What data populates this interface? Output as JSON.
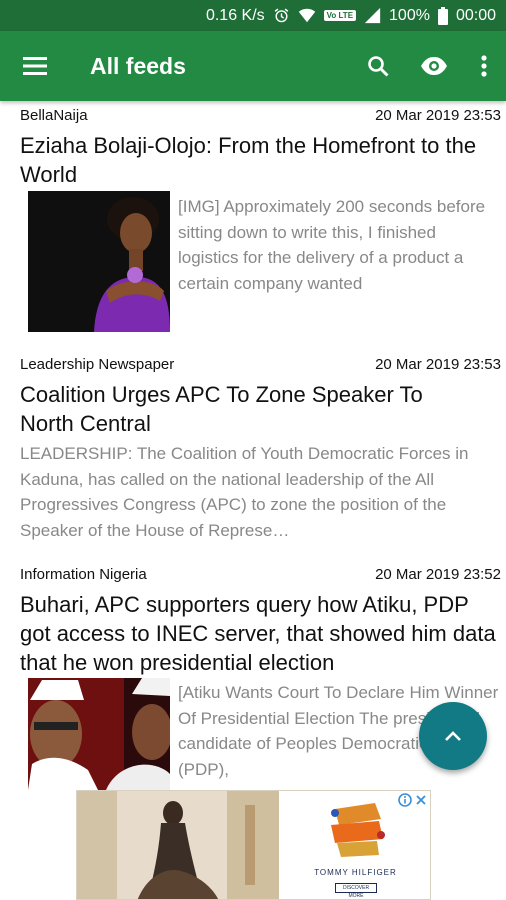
{
  "status_bar": {
    "speed": "0.16 K/s",
    "volte": "Vo LTE",
    "battery": "100%",
    "time": "00:00"
  },
  "toolbar": {
    "title": "All feeds",
    "menu_icon": "hamburger-menu-icon",
    "search_icon": "search-icon",
    "eye_icon": "eye-icon",
    "overflow_icon": "more-vert-icon",
    "color": "#238a43"
  },
  "feed": [
    {
      "source": "BellaNaija",
      "date": "20 Mar 2019 23:53",
      "title": "Eziaha Bolaji-Olojo: From the Homefront to the World",
      "snippet": "[IMG] Approximately 200 seconds before sitting down to write this, I finished logistics for the delivery of a product a certain company wanted"
    },
    {
      "source": "Leadership Newspaper",
      "date": "20 Mar 2019 23:53",
      "title": "Coalition Urges APC To Zone Speaker To North Central",
      "snippet": "LEADERSHIP: The Coalition of Youth Democratic Forces in Kaduna, has called on the national leadership of the All Progressives Congress (APC) to zone the position of the Speaker of the House of Represe…"
    },
    {
      "source": "Information Nigeria",
      "date": "20 Mar 2019 23:52",
      "title": "Buhari, APC supporters query how Atiku, PDP got access to INEC server, that showed him data that he won presidential election",
      "snippet": "[Atiku Wants Court To Declare Him Winner Of Presidential Election The presidential candidate of Peoples Democratic Party (PDP),"
    }
  ],
  "fab": {
    "icon": "chevron-up-icon",
    "color": "#127a84"
  },
  "ad": {
    "brand": "TOMMY HILFIGER",
    "cta": "DISCOVER MORE",
    "choices_icon": "ad-choices-icon",
    "close_icon": "close-icon"
  }
}
